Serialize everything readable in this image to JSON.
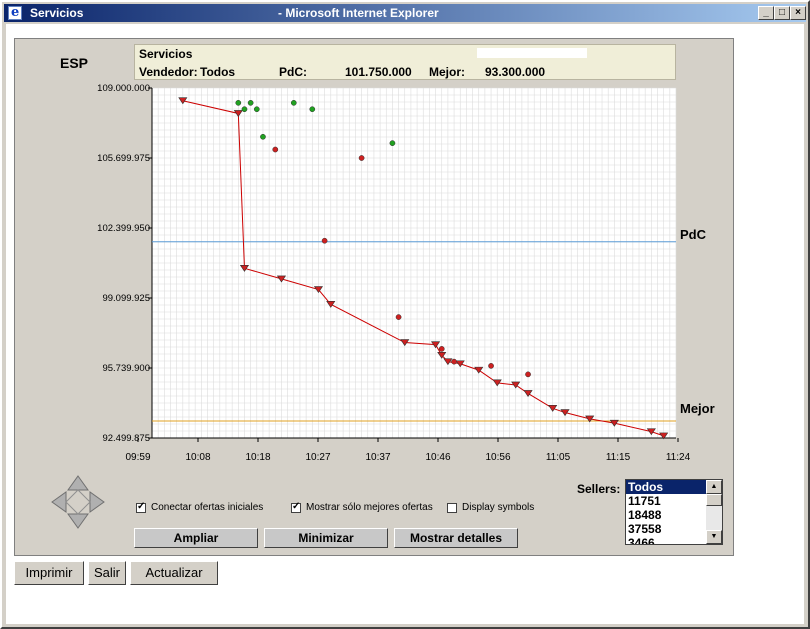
{
  "window": {
    "title": "Servicios",
    "app": "- Microsoft Internet Explorer",
    "min": "_",
    "max": "□",
    "close": "×"
  },
  "info": {
    "title": "Servicios",
    "vendedor_label": "Vendedor:",
    "vendedor_value": "Todos",
    "pdc_label": "PdC:",
    "pdc_value": "101.750.000",
    "mejor_label": "Mejor:",
    "mejor_value": "93.300.000"
  },
  "chart_data": {
    "type": "scatter",
    "ylabel": "ESP",
    "xlabel": "",
    "ylim": [
      92499875,
      109000000
    ],
    "xlim": [
      "09:59",
      "11:24"
    ],
    "x_ticks": [
      "09:59",
      "10:08",
      "10:18",
      "10:27",
      "10:37",
      "10:46",
      "10:56",
      "11:05",
      "11:15",
      "11:24"
    ],
    "y_ticks": [
      "109.000.000",
      "105.699.975",
      "102.399.950",
      "99.099.925",
      "95.739.900",
      "92.499.875"
    ],
    "grid": true,
    "reference_lines": [
      {
        "label": "PdC",
        "value": 101750000,
        "color": "#5b9bd5"
      },
      {
        "label": "Mejor",
        "value": 93300000,
        "color": "#e0a020"
      }
    ],
    "best_offers_line": {
      "color": "#cc0000",
      "x": [
        "10:04",
        "10:13",
        "10:14",
        "10:20",
        "10:26",
        "10:28",
        "10:40",
        "10:45",
        "10:46",
        "10:47",
        "10:49",
        "10:52",
        "10:55",
        "10:58",
        "11:00",
        "11:04",
        "11:06",
        "11:10",
        "11:14",
        "11:20",
        "11:22"
      ],
      "y": [
        108400000,
        107800000,
        100500000,
        100000000,
        99500000,
        98800000,
        97000000,
        96900000,
        96400000,
        96100000,
        96000000,
        95700000,
        95100000,
        95000000,
        94600000,
        93900000,
        93700000,
        93400000,
        93200000,
        92800000,
        92600000
      ]
    },
    "other_offers": [
      {
        "x": "10:13",
        "y": 108300000,
        "color": "#20a020"
      },
      {
        "x": "10:14",
        "y": 108000000,
        "color": "#20a020"
      },
      {
        "x": "10:15",
        "y": 108300000,
        "color": "#20a020"
      },
      {
        "x": "10:16",
        "y": 108000000,
        "color": "#20a020"
      },
      {
        "x": "10:17",
        "y": 106700000,
        "color": "#20a020"
      },
      {
        "x": "10:22",
        "y": 108300000,
        "color": "#20a020"
      },
      {
        "x": "10:25",
        "y": 108000000,
        "color": "#20a020"
      },
      {
        "x": "10:38",
        "y": 106400000,
        "color": "#20a020"
      },
      {
        "x": "10:19",
        "y": 106100000,
        "color": "#cc2020"
      },
      {
        "x": "10:33",
        "y": 105700000,
        "color": "#cc2020"
      },
      {
        "x": "10:27",
        "y": 101800000,
        "color": "#cc2020"
      },
      {
        "x": "10:39",
        "y": 98200000,
        "color": "#cc2020"
      },
      {
        "x": "10:46",
        "y": 96700000,
        "color": "#cc2020"
      },
      {
        "x": "10:48",
        "y": 96100000,
        "color": "#cc2020"
      },
      {
        "x": "10:54",
        "y": 95900000,
        "color": "#cc2020"
      },
      {
        "x": "11:00",
        "y": 95500000,
        "color": "#cc2020"
      }
    ]
  },
  "labels": {
    "esp": "ESP",
    "pdc": "PdC",
    "mejor": "Mejor"
  },
  "options": {
    "conectar": "Conectar ofertas iniciales",
    "mostrar_mejores": "Mostrar sólo mejores ofertas",
    "display_symbols": "Display symbols"
  },
  "buttons": {
    "ampliar": "Ampliar",
    "minimizar": "Minimizar",
    "mostrar_detalles": "Mostrar detalles",
    "imprimir": "Imprimir",
    "salir": "Salir",
    "actualizar": "Actualizar"
  },
  "sellers": {
    "label": "Sellers:",
    "items": [
      "Todos",
      "11751",
      "18488",
      "37558",
      "3466"
    ]
  },
  "icons": {
    "nav": "navigation-arrows-icon",
    "up": "▲",
    "down": "▼"
  }
}
